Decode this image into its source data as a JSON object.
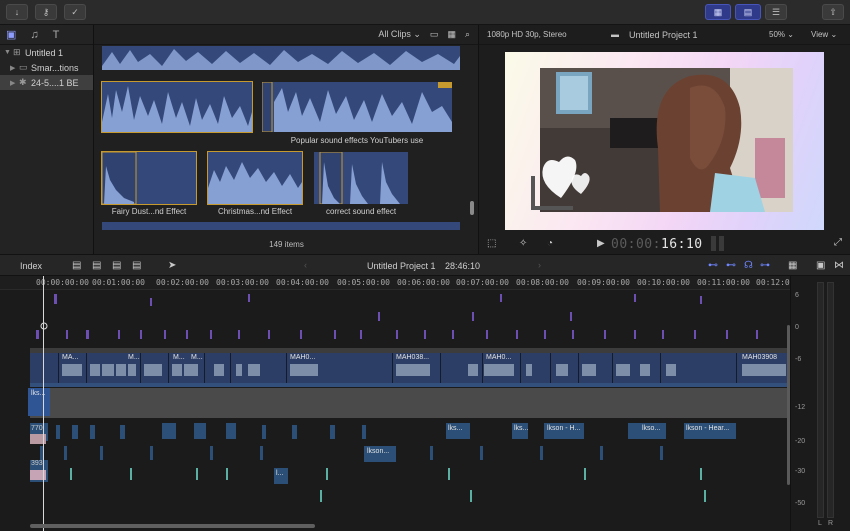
{
  "library": {
    "items": [
      {
        "label": "Untitled 1",
        "expanded": true
      },
      {
        "label": "Smar...tions",
        "expanded": false
      },
      {
        "label": "24-5....1 BE",
        "expanded": false,
        "selected": true
      }
    ]
  },
  "browser": {
    "filter_label": "All Clips",
    "items_count": "149 items",
    "clip_labels": {
      "popular": "Popular sound effects YouTubers use",
      "fairy": "Fairy Dust...nd Effect",
      "christmas": "Christmas...nd Effect",
      "correct": "correct sound effect"
    }
  },
  "viewer": {
    "format": "1080p HD 30p, Stereo",
    "title": "Untitled Project 1",
    "zoom": "50%",
    "view_label": "View",
    "timecode_dim": "00:00:",
    "timecode": "16:10"
  },
  "timeline": {
    "index_label": "Index",
    "project_title": "Untitled Project 1",
    "duration": "28:46:10",
    "ruler_labels": [
      "00:00:00:00",
      "00:01:00:00",
      "00:02:00:00",
      "00:03:00:00",
      "00:04:00:00",
      "00:05:00:00",
      "00:06:00:00",
      "00:07:00:00",
      "00:08:00:00",
      "00:09:00:00",
      "00:10:00:00",
      "00:11:00:00",
      "00:12:0"
    ],
    "clip_titles": [
      "MA...",
      "M...",
      "M...",
      "M...",
      "MAH0...",
      "MAH038...",
      "MAH0...",
      "MAH03908"
    ],
    "audio_labels": {
      "a1": "lks...",
      "a2": "lks...",
      "a3": "lks...",
      "a4": "lkson - H...",
      "a5": "lkso...",
      "a6": "lkson - Hear...",
      "a7": "lkson...",
      "a8": "l..."
    },
    "lane_markers": {
      "a": "770",
      "b": "393"
    }
  },
  "meter": {
    "labels": [
      "6",
      "0",
      "-6",
      "-12",
      "-20",
      "-30",
      "-50"
    ],
    "channels": [
      "L",
      "R"
    ]
  }
}
